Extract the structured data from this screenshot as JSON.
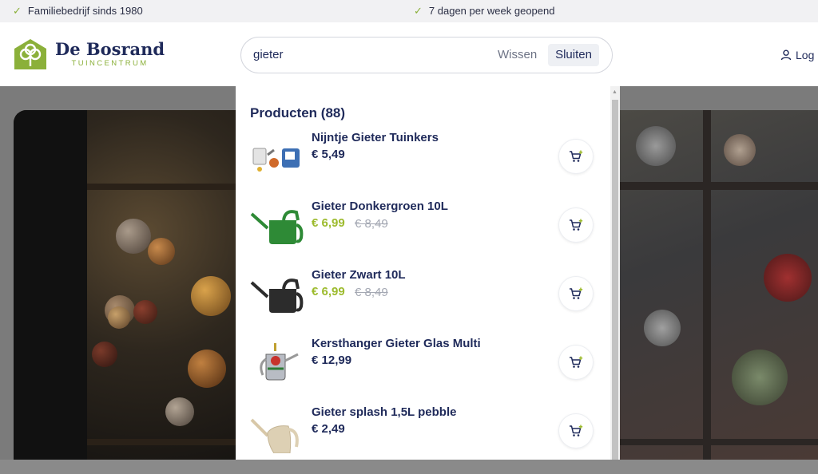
{
  "topbar": {
    "usp1": "Familiebedrijf sinds 1980",
    "usp2": "7 dagen per week geopend",
    "check_icon": "check-icon"
  },
  "header": {
    "logo_name": "De Bosrand",
    "logo_sub": "TUINCENTRUM",
    "login_label": "Log"
  },
  "search": {
    "value": "gieter",
    "clear_label": "Wissen",
    "close_label": "Sluiten"
  },
  "results": {
    "heading": "Producten (88)",
    "products": [
      {
        "title": "Nijntje Gieter Tuinkers",
        "price": "€ 5,49",
        "old_price": ""
      },
      {
        "title": "Gieter Donkergroen 10L",
        "price": "€ 6,99",
        "old_price": "€ 8,49"
      },
      {
        "title": "Gieter Zwart 10L",
        "price": "€ 6,99",
        "old_price": "€ 8,49"
      },
      {
        "title": "Kersthanger Gieter Glas Multi",
        "price": "€ 12,99",
        "old_price": ""
      },
      {
        "title": "Gieter splash 1,5L pebble",
        "price": "€ 2,49",
        "old_price": ""
      }
    ]
  },
  "colors": {
    "navy": "#1f2a5a",
    "accent_green": "#8bb03a",
    "sale_green": "#9dbb2e"
  }
}
